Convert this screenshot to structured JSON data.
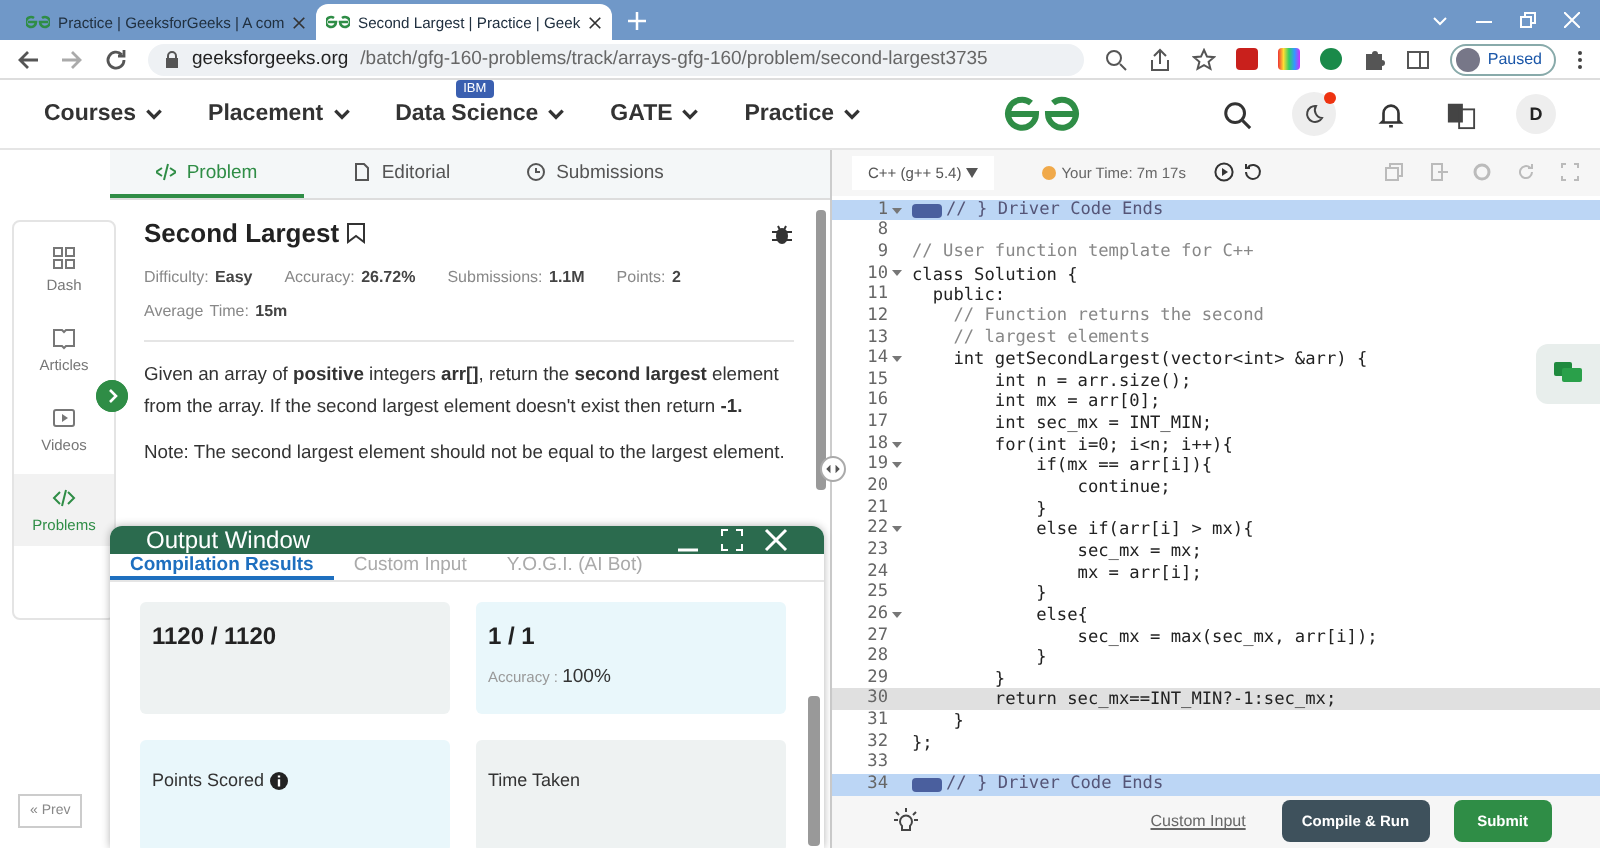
{
  "browser": {
    "tabs": [
      {
        "title": "Practice | GeeksforGeeks | A com",
        "selected": false
      },
      {
        "title": "Second Largest | Practice | Geek",
        "selected": true
      }
    ],
    "url_host": "geeksforgeeks.org",
    "url_path": "/batch/gfg-160-problems/track/arrays-gfg-160/problem/second-largest3735",
    "profile": "Paused"
  },
  "site_nav": {
    "items": [
      {
        "label": "Courses"
      },
      {
        "label": "Placement"
      },
      {
        "label": "Data Science",
        "badge": "IBM"
      },
      {
        "label": "GATE"
      },
      {
        "label": "Practice"
      }
    ],
    "notification_dot": true,
    "avatar": "D"
  },
  "problem_tabs": [
    {
      "label": "Problem",
      "selected": true
    },
    {
      "label": "Editorial",
      "selected": false
    },
    {
      "label": "Submissions",
      "selected": false
    }
  ],
  "sidebar": {
    "items": [
      {
        "label": "Dash",
        "selected": false
      },
      {
        "label": "Articles",
        "selected": false
      },
      {
        "label": "Videos",
        "selected": false
      },
      {
        "label": "Problems",
        "selected": true
      }
    ],
    "prev": "« Prev"
  },
  "problem": {
    "title": "Second Largest",
    "stats": [
      {
        "label": "Difficulty: ",
        "value": "Easy"
      },
      {
        "label": "Accuracy: ",
        "value": "26.72%"
      },
      {
        "label": "Submissions: ",
        "value": "1.1M"
      },
      {
        "label": "Points: ",
        "value": "2"
      },
      {
        "label": "Average Time: ",
        "value": "15m"
      }
    ],
    "description": "Given an array of **positive** integers **arr[]**, return the **second largest** element from the array. If the second largest element doesn't exist then return **-1.**",
    "note": "Note: The second largest element should not be equal to the largest element."
  },
  "output_window": {
    "title": "Output Window",
    "tabs": [
      {
        "label": "Compilation Results",
        "selected": true
      },
      {
        "label": "Custom Input",
        "selected": false
      },
      {
        "label": "Y.O.G.I. (AI Bot)",
        "selected": false
      }
    ],
    "cards": [
      {
        "color": "#eef2f2",
        "value": "1120 / 1120"
      },
      {
        "color": "#e9f7fb",
        "value": "1 / 1",
        "caption_label": "Accuracy : ",
        "caption_value": "100%"
      },
      {
        "color": "#e9f7fb",
        "label": "Points Scored",
        "info": true
      },
      {
        "color": "#eef2f2",
        "label": "Time Taken"
      }
    ]
  },
  "editor": {
    "language": "C++ (g++ 5.4)",
    "timer": "Your Time: 7m 17s",
    "lines": [
      {
        "number": "1",
        "text": "// } Driver Code Ends",
        "kind": "marker",
        "foldable": true,
        "highlighted": true,
        "current": false
      },
      {
        "number": "8",
        "kind": "code",
        "foldable": false,
        "highlighted": false,
        "current": false
      },
      {
        "number": "9",
        "text": "// User function template for C++",
        "kind": "comment",
        "foldable": false,
        "highlighted": false,
        "current": false
      },
      {
        "number": "10",
        "text": "class Solution {",
        "kind": "code",
        "foldable": true,
        "highlighted": false,
        "current": false
      },
      {
        "number": "11",
        "text": "  public:",
        "kind": "code",
        "foldable": false,
        "highlighted": false,
        "current": false
      },
      {
        "number": "12",
        "text": "    // Function returns the second",
        "kind": "comment",
        "foldable": false,
        "highlighted": false,
        "current": false
      },
      {
        "number": "13",
        "text": "    // largest elements",
        "kind": "comment",
        "foldable": false,
        "highlighted": false,
        "current": false
      },
      {
        "number": "14",
        "text": "    int getSecondLargest(vector<int> &arr) {",
        "kind": "code",
        "foldable": true,
        "highlighted": false,
        "current": false
      },
      {
        "number": "15",
        "text": "        int n = arr.size();",
        "kind": "code",
        "foldable": false,
        "highlighted": false,
        "current": false
      },
      {
        "number": "16",
        "text": "        int mx = arr[0];",
        "kind": "code",
        "foldable": false,
        "highlighted": false,
        "current": false
      },
      {
        "number": "17",
        "text": "        int sec_mx = INT_MIN;",
        "kind": "code",
        "foldable": false,
        "highlighted": false,
        "current": false
      },
      {
        "number": "18",
        "text": "        for(int i=0; i<n; i++){",
        "kind": "code",
        "foldable": true,
        "highlighted": false,
        "current": false
      },
      {
        "number": "19",
        "text": "            if(mx == arr[i]){",
        "kind": "code",
        "foldable": true,
        "highlighted": false,
        "current": false
      },
      {
        "number": "20",
        "text": "                continue;",
        "kind": "code",
        "foldable": false,
        "highlighted": false,
        "current": false
      },
      {
        "number": "21",
        "text": "            }",
        "kind": "code",
        "foldable": false,
        "highlighted": false,
        "current": false
      },
      {
        "number": "22",
        "text": "            else if(arr[i] > mx){",
        "kind": "code",
        "foldable": true,
        "highlighted": false,
        "current": false
      },
      {
        "number": "23",
        "text": "                sec_mx = mx;",
        "kind": "code",
        "foldable": false,
        "highlighted": false,
        "current": false
      },
      {
        "number": "24",
        "text": "                mx = arr[i];",
        "kind": "code",
        "foldable": false,
        "highlighted": false,
        "current": false
      },
      {
        "number": "25",
        "text": "            }",
        "kind": "code",
        "foldable": false,
        "highlighted": false,
        "current": false
      },
      {
        "number": "26",
        "text": "            else{",
        "kind": "code",
        "foldable": true,
        "highlighted": false,
        "current": false
      },
      {
        "number": "27",
        "text": "                sec_mx = max(sec_mx, arr[i]);",
        "kind": "code",
        "foldable": false,
        "highlighted": false,
        "current": false
      },
      {
        "number": "28",
        "text": "            }",
        "kind": "code",
        "foldable": false,
        "highlighted": false,
        "current": false
      },
      {
        "number": "29",
        "text": "        }",
        "kind": "code",
        "foldable": false,
        "highlighted": false,
        "current": false
      },
      {
        "number": "30",
        "text": "        return sec_mx==INT_MIN?-1:sec_mx;",
        "kind": "code",
        "foldable": false,
        "highlighted": false,
        "current": true
      },
      {
        "number": "31",
        "text": "    }",
        "kind": "code",
        "foldable": false,
        "highlighted": false,
        "current": false
      },
      {
        "number": "32",
        "text": "};",
        "kind": "code",
        "foldable": false,
        "highlighted": false,
        "current": false
      },
      {
        "number": "33",
        "kind": "code",
        "foldable": false,
        "highlighted": false,
        "current": false
      },
      {
        "number": "34",
        "text": "// } Driver Code Ends",
        "kind": "marker",
        "foldable": false,
        "highlighted": true,
        "current": false
      }
    ],
    "custom_input": "Custom Input",
    "compile": "Compile & Run",
    "submit": "Submit"
  }
}
